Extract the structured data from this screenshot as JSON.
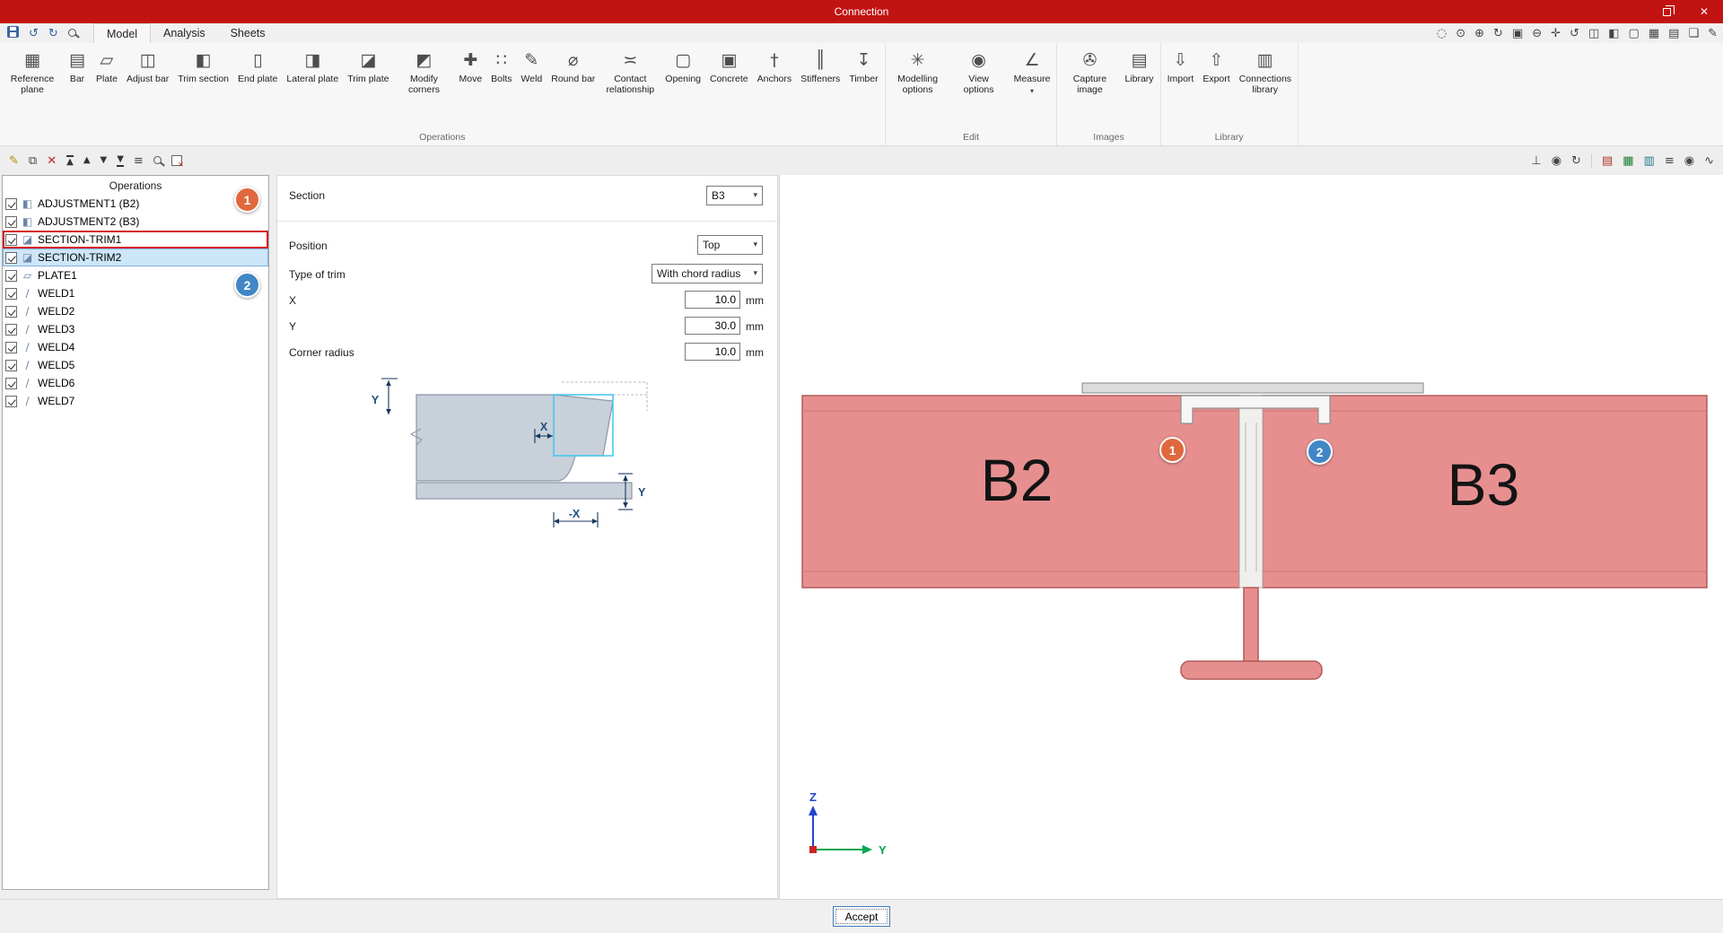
{
  "window": {
    "title": "Connection"
  },
  "icons": {
    "close": "✕",
    "dropdown": "▾",
    "undo": "↺",
    "redo": "↻"
  },
  "tabs": {
    "items": [
      {
        "label": "Model"
      },
      {
        "label": "Analysis"
      },
      {
        "label": "Sheets"
      }
    ]
  },
  "view_toolbar": {
    "items": [
      {
        "name": "zoom-previous",
        "glyph": "◌"
      },
      {
        "name": "zoom-extents",
        "glyph": "⊙"
      },
      {
        "name": "zoom-in",
        "glyph": "⊕"
      },
      {
        "name": "refresh",
        "glyph": "↻"
      },
      {
        "name": "zoom-window",
        "glyph": "▣"
      },
      {
        "name": "zoom-out",
        "glyph": "⊖"
      },
      {
        "name": "pan",
        "glyph": "✛"
      },
      {
        "name": "orbit",
        "glyph": "↺"
      },
      {
        "name": "view-cube",
        "glyph": "◫"
      },
      {
        "name": "split-view",
        "glyph": "◧"
      },
      {
        "name": "monitor",
        "glyph": "▢"
      },
      {
        "name": "diagram",
        "glyph": "▦"
      },
      {
        "name": "clipboard",
        "glyph": "▤"
      },
      {
        "name": "comment",
        "glyph": "❏"
      },
      {
        "name": "annotate",
        "glyph": "✎"
      }
    ]
  },
  "ribbon": {
    "groups": [
      {
        "label": "Operations",
        "items": [
          {
            "label": "Reference plane",
            "icon": "▦"
          },
          {
            "label": "Bar",
            "icon": "▤"
          },
          {
            "label": "Plate",
            "icon": "▱"
          },
          {
            "label": "Adjust bar",
            "icon": "◫"
          },
          {
            "label": "Trim section",
            "icon": "◧"
          },
          {
            "label": "End plate",
            "icon": "▯"
          },
          {
            "label": "Lateral plate",
            "icon": "◨"
          },
          {
            "label": "Trim plate",
            "icon": "◪"
          },
          {
            "label": "Modify corners",
            "icon": "◩"
          },
          {
            "label": "Move",
            "icon": "✚"
          },
          {
            "label": "Bolts",
            "icon": "∷"
          },
          {
            "label": "Weld",
            "icon": "✎"
          },
          {
            "label": "Round bar",
            "icon": "⌀"
          },
          {
            "label": "Contact relationship",
            "icon": "≍"
          },
          {
            "label": "Opening",
            "icon": "▢"
          },
          {
            "label": "Concrete",
            "icon": "▣"
          },
          {
            "label": "Anchors",
            "icon": "†"
          },
          {
            "label": "Stiffeners",
            "icon": "║"
          },
          {
            "label": "Timber",
            "icon": "↧"
          }
        ]
      },
      {
        "label": "Edit",
        "items": [
          {
            "label": "Modelling options",
            "icon": "✳"
          },
          {
            "label": "View options",
            "icon": "◉"
          },
          {
            "label": "Measure",
            "icon": "∠"
          }
        ]
      },
      {
        "label": "Images",
        "items": [
          {
            "label": "Capture image",
            "icon": "✇"
          },
          {
            "label": "Library",
            "icon": "▤"
          }
        ]
      },
      {
        "label": "Library",
        "items": [
          {
            "label": "Import",
            "icon": "⇩"
          },
          {
            "label": "Export",
            "icon": "⇧"
          },
          {
            "label": "Connections library",
            "icon": "▥"
          }
        ]
      }
    ]
  },
  "tree_toolbar": {
    "items": [
      {
        "name": "edit",
        "glyph": "✎"
      },
      {
        "name": "copy",
        "glyph": "⧉"
      },
      {
        "name": "delete",
        "glyph": "✕"
      },
      {
        "name": "move-first",
        "glyph": "▲"
      },
      {
        "name": "move-up",
        "glyph": "▲"
      },
      {
        "name": "move-down",
        "glyph": "▼"
      },
      {
        "name": "move-last",
        "glyph": "▼"
      },
      {
        "name": "tree-structure",
        "glyph": "≡"
      }
    ]
  },
  "workspace_toolbar": {
    "items": [
      {
        "name": "axes",
        "glyph": "⊥"
      },
      {
        "name": "visibility",
        "glyph": "◉"
      },
      {
        "name": "orbit",
        "glyph": "↻"
      },
      {
        "name": "report",
        "glyph": "▤"
      },
      {
        "name": "sheet",
        "glyph": "▦"
      },
      {
        "name": "table",
        "glyph": "▥"
      },
      {
        "name": "layers",
        "glyph": "≡"
      },
      {
        "name": "preview",
        "glyph": "◉"
      },
      {
        "name": "connector",
        "glyph": "∿"
      }
    ]
  },
  "operations_panel": {
    "title": "Operations",
    "items": [
      {
        "label": "ADJUSTMENT1 (B2)",
        "checked": true,
        "icon": "◧"
      },
      {
        "label": "ADJUSTMENT2 (B3)",
        "checked": true,
        "icon": "◧"
      },
      {
        "label": "SECTION-TRIM1",
        "checked": true,
        "icon": "◪"
      },
      {
        "label": "SECTION-TRIM2",
        "checked": true,
        "icon": "◪"
      },
      {
        "label": "PLATE1",
        "checked": true,
        "icon": "▱"
      },
      {
        "label": "WELD1",
        "checked": true,
        "icon": "∕"
      },
      {
        "label": "WELD2",
        "checked": true,
        "icon": "∕"
      },
      {
        "label": "WELD3",
        "checked": true,
        "icon": "∕"
      },
      {
        "label": "WELD4",
        "checked": true,
        "icon": "∕"
      },
      {
        "label": "WELD5",
        "checked": true,
        "icon": "∕"
      },
      {
        "label": "WELD6",
        "checked": true,
        "icon": "∕"
      },
      {
        "label": "WELD7",
        "checked": true,
        "icon": "∕"
      }
    ]
  },
  "properties": {
    "section_label": "Section",
    "section_value": "B3",
    "position_label": "Position",
    "position_value": "Top",
    "trim_label": "Type of trim",
    "trim_value": "With chord radius",
    "x_label": "X",
    "x_value": "10.0",
    "x_unit": "mm",
    "y_label": "Y",
    "y_value": "30.0",
    "y_unit": "mm",
    "radius_label": "Corner radius",
    "radius_value": "10.0",
    "radius_unit": "mm",
    "sketch": {
      "y_top": "Y",
      "x_top": "X",
      "x_bottom": "-X",
      "y_right": "Y"
    }
  },
  "viewport": {
    "beam_left": "B2",
    "beam_right": "B3",
    "badge_1": "1",
    "badge_2": "2",
    "axis_z": "Z",
    "axis_y": "Y"
  },
  "tree_badges": {
    "badge_1": "1",
    "badge_2": "2"
  },
  "footer": {
    "accept": "Accept"
  },
  "colors": {
    "titlebar": "#c21313",
    "beam_fill": "#e78f8f",
    "beam_stroke": "#b25b5b",
    "badge_orange": "#e0683e",
    "badge_blue": "#4187c6",
    "selection_bg": "#cde6f8",
    "annotation_red": "#d42020",
    "dimension_blue": "#17365d"
  }
}
